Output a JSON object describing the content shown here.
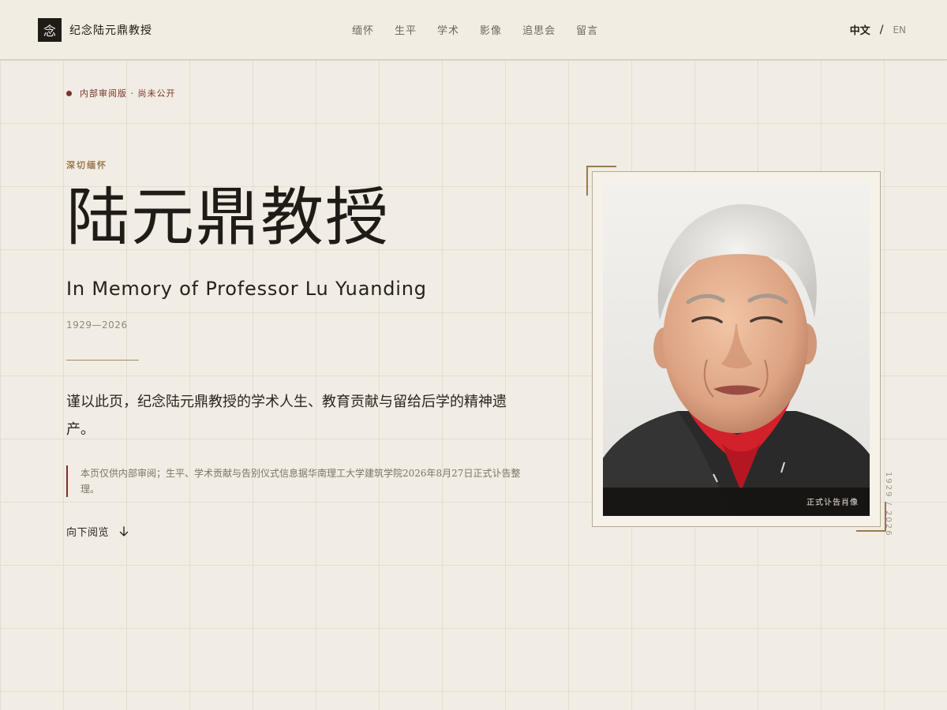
{
  "header": {
    "brand_mark": "念",
    "brand_name": "纪念陆元鼎教授",
    "nav": [
      "缅怀",
      "生平",
      "学术",
      "影像",
      "追思会",
      "留言"
    ],
    "lang_zh": "中文",
    "lang_separator": "/",
    "lang_en": "EN"
  },
  "hero": {
    "review_badge": "内部审阅版 · 尚未公开",
    "eyebrow": "深切缅怀",
    "title": "陆元鼎教授",
    "subtitle": "In Memory of Professor Lu Yuanding",
    "years": "1929—2026",
    "lead": "谨以此页，纪念陆元鼎教授的学术人生、教育贡献与留给后学的精神遗产。",
    "notice": "本页仅供内部审阅；生平、学术贡献与告别仪式信息据华南理工大学建筑学院2026年8月27日正式讣告整理。",
    "scroll_label": "向下阅览"
  },
  "portrait": {
    "caption": "正式讣告肖像",
    "side_years": "1929 / 2026"
  },
  "icons": {
    "scroll": "arrow-down-icon"
  },
  "colors": {
    "background": "#f1ece4",
    "accent_gold": "#9b7a4c",
    "accent_red": "#7a3428",
    "ink": "#1f1b17"
  }
}
